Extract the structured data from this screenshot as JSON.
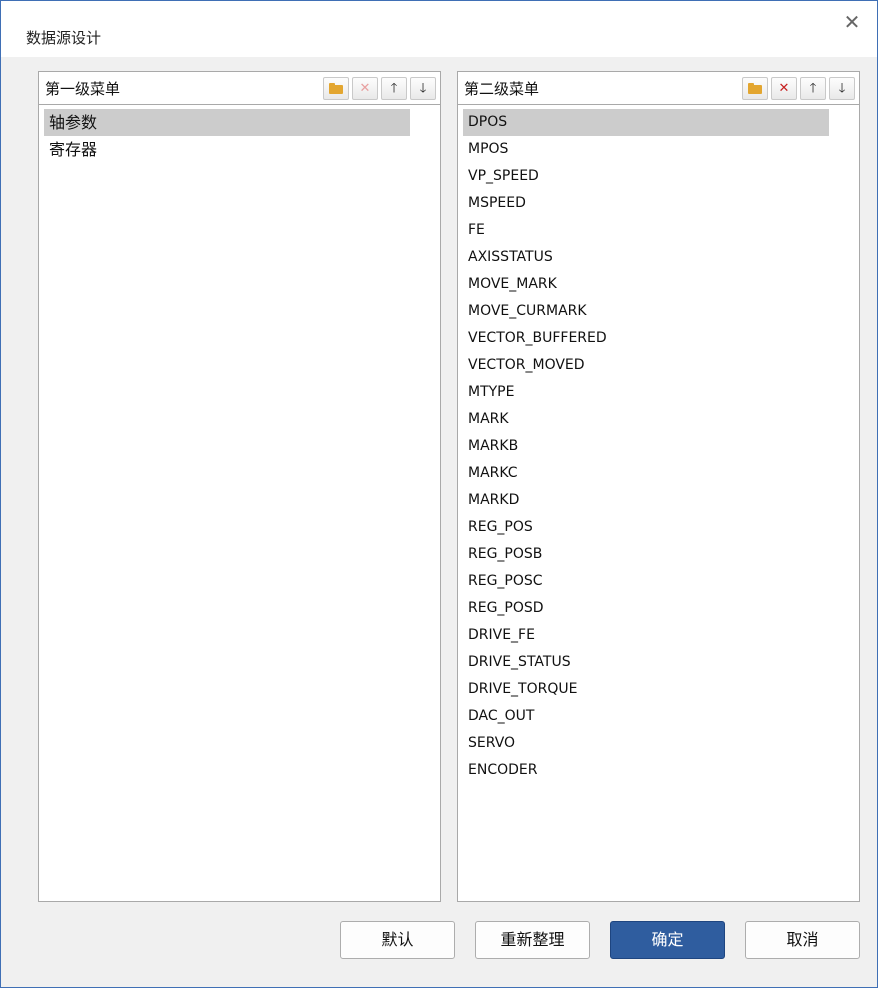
{
  "dialog": {
    "title": "数据源设计",
    "close_label": "✕"
  },
  "left_panel": {
    "title": "第一级菜单",
    "toolbar": {
      "add_icon": "folder-add-icon",
      "delete": "✕",
      "up": "🡑",
      "down": "🡓"
    },
    "items": [
      "轴参数",
      "寄存器"
    ],
    "selected_index": 0
  },
  "right_panel": {
    "title": "第二级菜单",
    "toolbar": {
      "add_icon": "folder-add-icon",
      "delete": "✕",
      "up": "🡑",
      "down": "🡓"
    },
    "items": [
      "DPOS",
      "MPOS",
      "VP_SPEED",
      "MSPEED",
      "FE",
      "AXISSTATUS",
      "MOVE_MARK",
      "MOVE_CURMARK",
      "VECTOR_BUFFERED",
      "VECTOR_MOVED",
      "MTYPE",
      "MARK",
      "MARKB",
      "MARKC",
      "MARKD",
      "REG_POS",
      "REG_POSB",
      "REG_POSC",
      "REG_POSD",
      "DRIVE_FE",
      "DRIVE_STATUS",
      "DRIVE_TORQUE",
      "DAC_OUT",
      "SERVO",
      "ENCODER"
    ],
    "selected_index": 0
  },
  "buttons": {
    "default": "默认",
    "reorganize": "重新整理",
    "ok": "确定",
    "cancel": "取消"
  },
  "colors": {
    "accent": "#2f5d9f",
    "selection": "#cccccc",
    "border": "#3f6fb5"
  }
}
